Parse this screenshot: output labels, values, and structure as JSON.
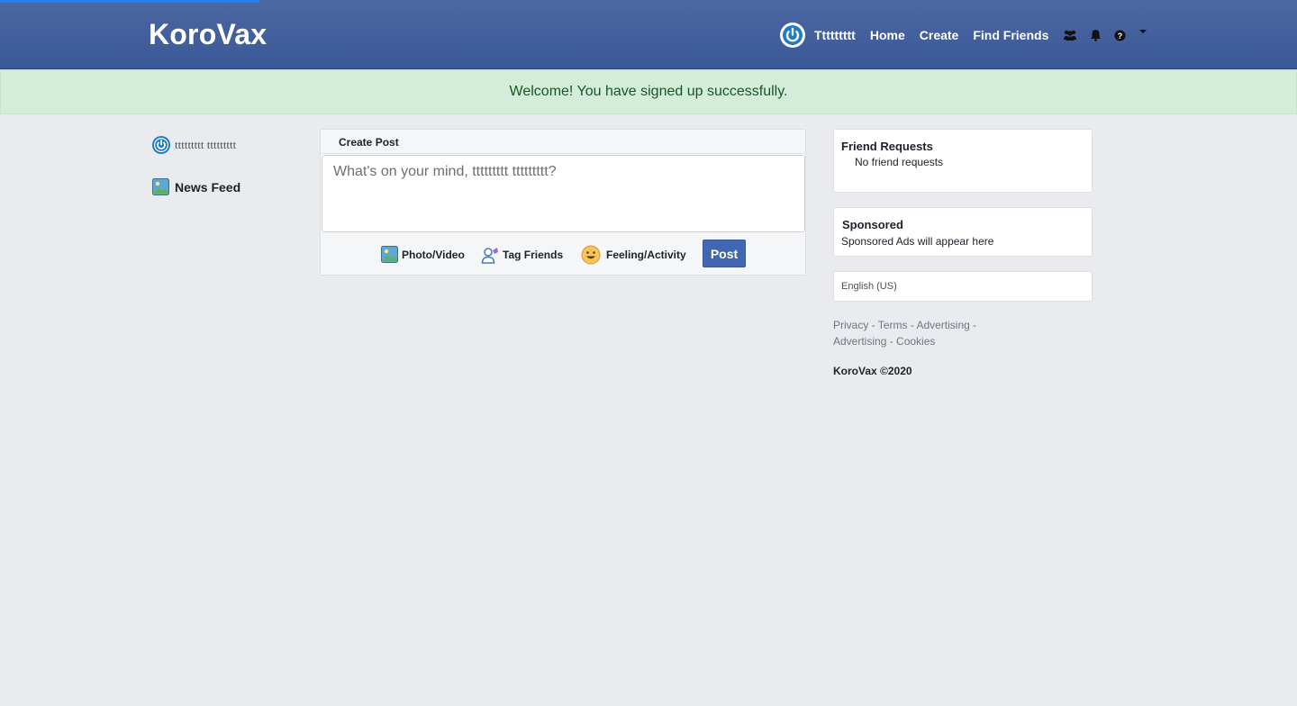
{
  "header": {
    "brand": "KoroVax",
    "username": "Ttttttttt",
    "home": "Home",
    "create": "Create",
    "find_friends": "Find Friends",
    "icons": [
      "friends-icon",
      "bell-icon",
      "help-icon",
      "caret-down-icon"
    ]
  },
  "alert": {
    "message": "Welcome! You have signed up successfully."
  },
  "left": {
    "user_name": "ttttttttt ttttttttt",
    "news_feed": "News Feed"
  },
  "post": {
    "header": "Create Post",
    "placeholder": "What's on your mind, ttttttttt ttttttttt?",
    "photo_video": "Photo/Video",
    "tag_friends": "Tag Friends",
    "feeling_activity": "Feeling/Activity",
    "post_button": "Post"
  },
  "right": {
    "friend_requests_title": "Friend Requests",
    "friend_requests_body": "No friend requests",
    "sponsored_title": "Sponsored",
    "sponsored_body": "Sponsored Ads will appear here",
    "language": "English (US)",
    "links_line1": "Privacy - Terms - Advertising -",
    "links_line2": "Advertising - Cookies",
    "copyright": "KoroVax ©2020"
  },
  "colors": {
    "header": "#3b5998",
    "alert_bg": "#d4edda",
    "alert_text": "#155724",
    "post_button": "#4267b2",
    "page_bg": "#e9ebee"
  }
}
